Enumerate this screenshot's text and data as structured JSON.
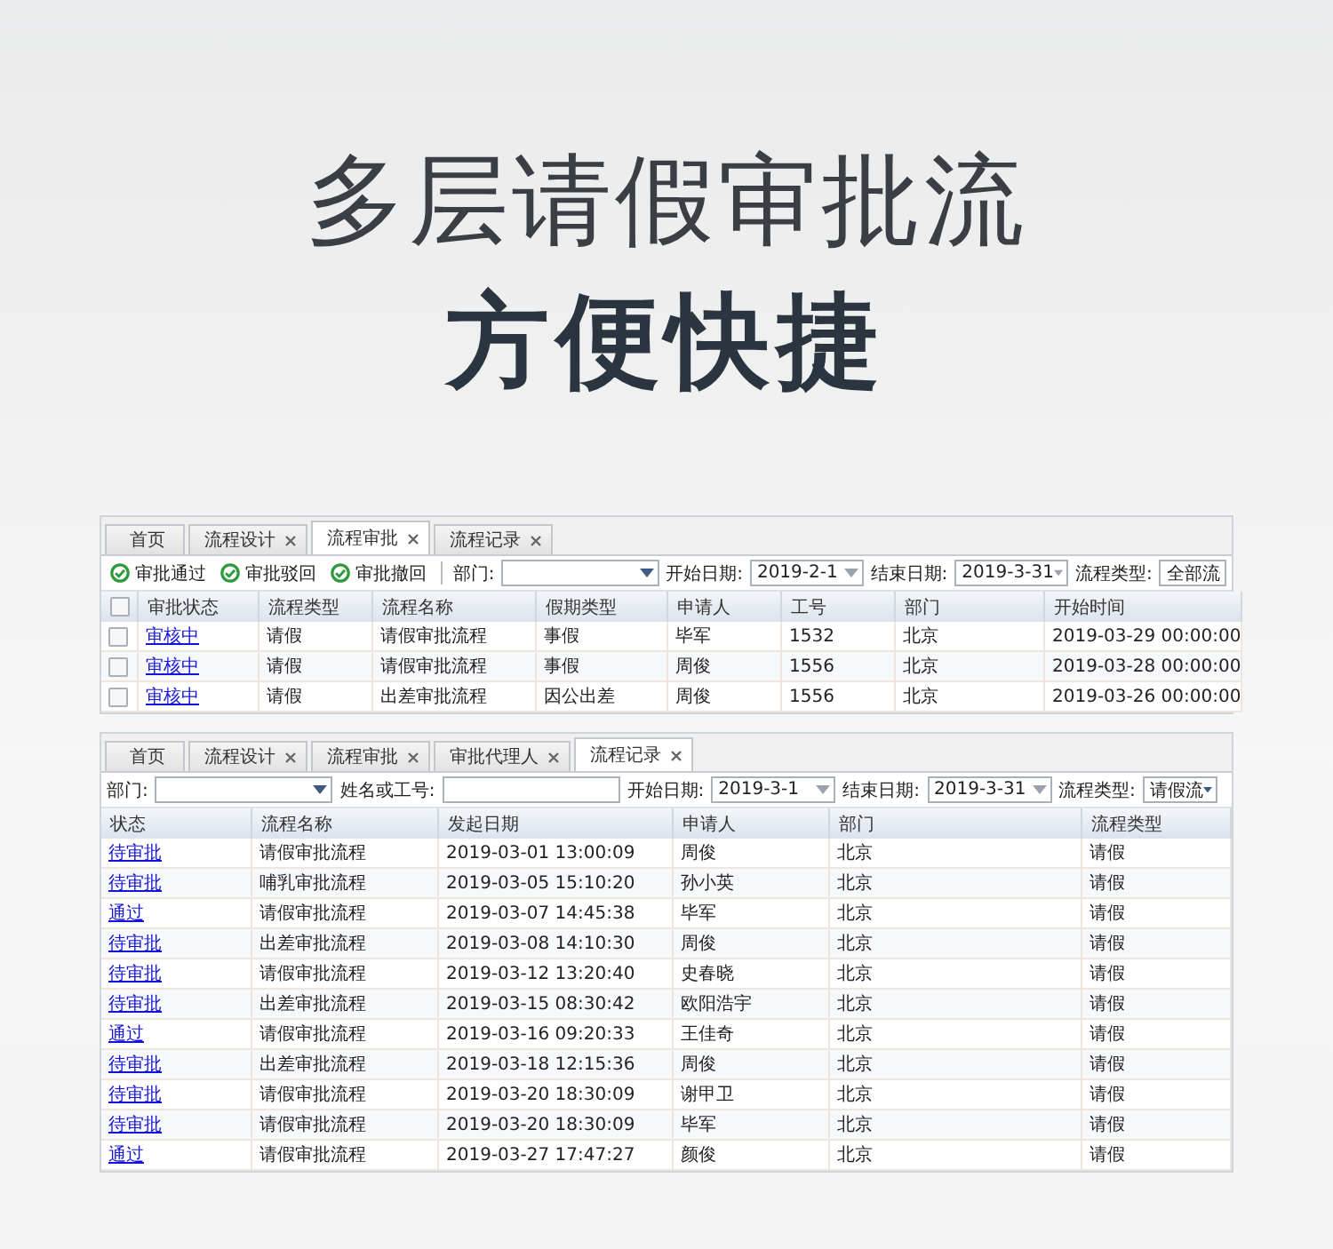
{
  "headline": {
    "line1": "多层请假审批流",
    "line2": "方便快捷"
  },
  "approval_panel": {
    "tabs": [
      {
        "label": "首页",
        "selected": false,
        "closable": false
      },
      {
        "label": "流程设计",
        "selected": false,
        "closable": true
      },
      {
        "label": "流程审批",
        "selected": true,
        "closable": true
      },
      {
        "label": "流程记录",
        "selected": false,
        "closable": true
      }
    ],
    "actions": [
      "审批通过",
      "审批驳回",
      "审批撤回"
    ],
    "filters": [
      {
        "label": "部门:",
        "kind": "select"
      },
      {
        "label": "开始日期:",
        "kind": "date",
        "value": "2019-2-1"
      },
      {
        "label": "结束日期:",
        "kind": "date",
        "value": "2019-3-31"
      },
      {
        "label": "流程类型:",
        "kind": "select",
        "value": "全部流"
      }
    ],
    "header_checked": false,
    "columns": [
      "审批状态",
      "流程类型",
      "流程名称",
      "假期类型",
      "申请人",
      "工号",
      "部门",
      "开始时间"
    ],
    "rows": [
      {
        "checked": false,
        "cells": [
          "审核中",
          "请假",
          "请假审批流程",
          "事假",
          "毕军",
          "1532",
          "北京",
          "2019-03-29 00:00:00"
        ]
      },
      {
        "checked": false,
        "cells": [
          "审核中",
          "请假",
          "请假审批流程",
          "事假",
          "周俊",
          "1556",
          "北京",
          "2019-03-28 00:00:00"
        ]
      },
      {
        "checked": false,
        "cells": [
          "审核中",
          "请假",
          "出差审批流程",
          "因公出差",
          "周俊",
          "1556",
          "北京",
          "2019-03-26 00:00:00"
        ]
      }
    ]
  },
  "record_panel": {
    "tabs": [
      {
        "label": "首页",
        "selected": false,
        "closable": false
      },
      {
        "label": "流程设计",
        "selected": false,
        "closable": true
      },
      {
        "label": "流程审批",
        "selected": false,
        "closable": true
      },
      {
        "label": "审批代理人",
        "selected": false,
        "closable": true
      },
      {
        "label": "流程记录",
        "selected": true,
        "closable": true
      }
    ],
    "filters": [
      {
        "label": "部门:",
        "kind": "select"
      },
      {
        "label": "姓名或工号:",
        "kind": "text"
      },
      {
        "label": "开始日期:",
        "kind": "date",
        "value": "2019-3-1"
      },
      {
        "label": "结束日期:",
        "kind": "date",
        "value": "2019-3-31"
      },
      {
        "label": "流程类型:",
        "kind": "select",
        "value": "请假流"
      }
    ],
    "columns": [
      "状态",
      "流程名称",
      "发起日期",
      "申请人",
      "部门",
      "流程类型"
    ],
    "rows": [
      [
        "待审批",
        "请假审批流程",
        "2019-03-01 13:00:09",
        "周俊",
        "北京",
        "请假"
      ],
      [
        "待审批",
        "哺乳审批流程",
        "2019-03-05 15:10:20",
        "孙小英",
        "北京",
        "请假"
      ],
      [
        "通过",
        "请假审批流程",
        "2019-03-07 14:45:38",
        "毕军",
        "北京",
        "请假"
      ],
      [
        "待审批",
        "出差审批流程",
        "2019-03-08 14:10:30",
        "周俊",
        "北京",
        "请假"
      ],
      [
        "待审批",
        "请假审批流程",
        "2019-03-12 13:20:40",
        "史春晓",
        "北京",
        "请假"
      ],
      [
        "待审批",
        "出差审批流程",
        "2019-03-15 08:30:42",
        "欧阳浩宇",
        "北京",
        "请假"
      ],
      [
        "通过",
        "请假审批流程",
        "2019-03-16 09:20:33",
        "王佳奇",
        "北京",
        "请假"
      ],
      [
        "待审批",
        "出差审批流程",
        "2019-03-18 12:15:36",
        "周俊",
        "北京",
        "请假"
      ],
      [
        "待审批",
        "请假审批流程",
        "2019-03-20 18:30:09",
        "谢甲卫",
        "北京",
        "请假"
      ],
      [
        "待审批",
        "请假审批流程",
        "2019-03-20 18:30:09",
        "毕军",
        "北京",
        "请假"
      ],
      [
        "通过",
        "请假审批流程",
        "2019-03-27 17:47:27",
        "颜俊",
        "北京",
        "请假"
      ]
    ]
  }
}
